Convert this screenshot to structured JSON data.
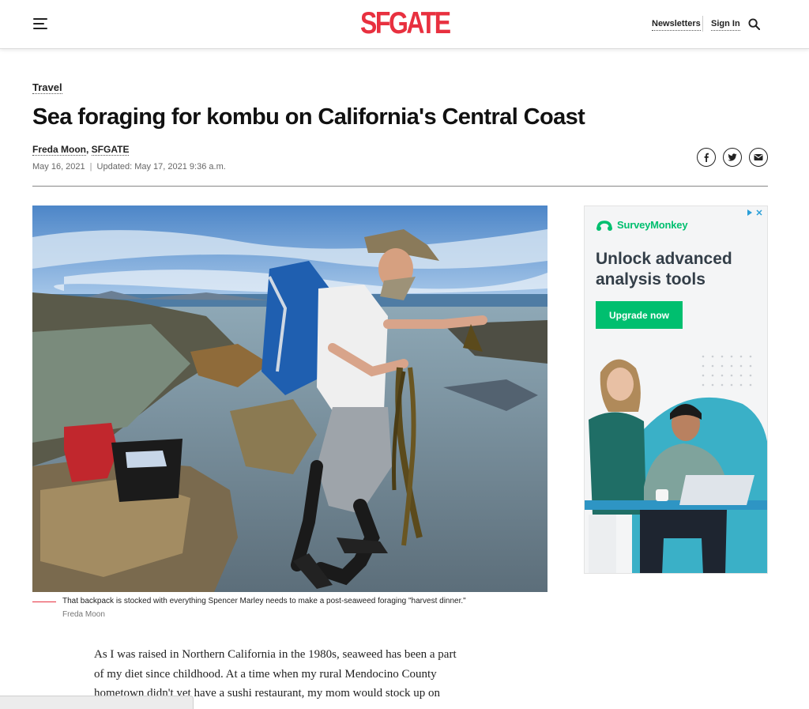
{
  "header": {
    "logo": "SFGATE",
    "links": {
      "newsletters": "Newsletters",
      "sign_in": "Sign In"
    }
  },
  "article": {
    "section": "Travel",
    "headline": "Sea foraging for kombu on California's Central Coast",
    "author": "Freda Moon",
    "publication": "SFGATE",
    "date": "May 16, 2021",
    "updated": "Updated: May 17, 2021 9:36 a.m.",
    "share": [
      "facebook-icon",
      "twitter-icon",
      "email-icon"
    ],
    "photo_caption": "That backpack is stocked with everything Spencer Marley needs to make a post-seaweed foraging \"harvest dinner.\"",
    "photo_credit": "Freda Moon",
    "body_lines": [
      "As I was raised in Northern California in the 1980s, seaweed has been a part",
      "of my diet since childhood. At a time when my rural Mendocino County",
      "hometown didn't yet have a sushi restaurant, my mom would stock up on"
    ]
  },
  "ad": {
    "brand": "SurveyMonkey",
    "headline": "Unlock advanced analysis tools",
    "cta": "Upgrade now"
  },
  "colors": {
    "brand_red": "#e8303f",
    "ad_green": "#00bf6f"
  }
}
